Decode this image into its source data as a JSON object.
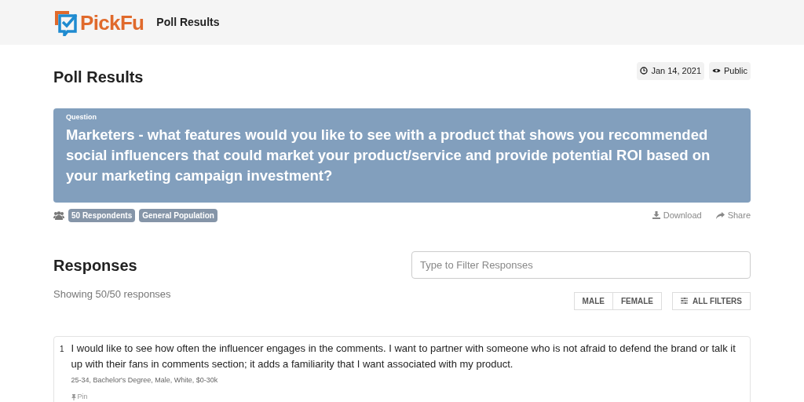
{
  "header": {
    "logo": "PickFu",
    "title": "Poll Results"
  },
  "page": {
    "title": "Poll Results",
    "date": "Jan 14, 2021",
    "visibility": "Public"
  },
  "question": {
    "label": "Question",
    "text": "Marketers - what features would you like to see with a product that shows you recommended social influencers that could market your product/service and provide potential ROI based on your marketing campaign investment?"
  },
  "tags": [
    "50 Respondents",
    "General Population"
  ],
  "actions": [
    "Download",
    "Share"
  ],
  "responses": {
    "title": "Responses",
    "summary": "Showing 50/50 responses",
    "filter": {
      "placeholder": "Type to Filter Responses"
    },
    "gender_filters": [
      {
        "label": "MALE",
        "selected": false
      },
      {
        "label": "FEMALE",
        "selected": false
      }
    ],
    "all_filters": "ALL FILTERS",
    "items": [
      {
        "number": "1",
        "text": "I would like to see how often the influencer engages in the comments. I want to partner with someone who is not afraid to defend the brand or talk it up with their fans in comments section; it adds a familiarity that I want associated with my product.",
        "demographics": "25-34, Bachelor's Degree, Male, White, $0-30k",
        "pin": "Pin"
      }
    ]
  }
}
